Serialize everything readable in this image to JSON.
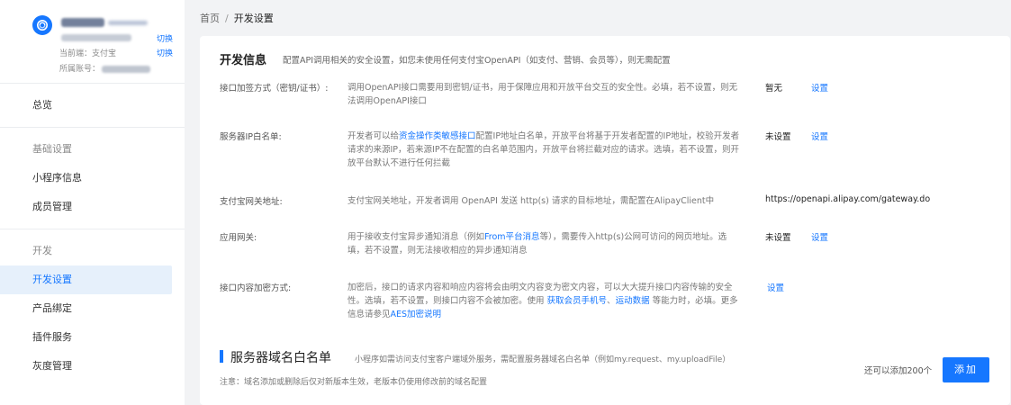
{
  "sidebar": {
    "switch_label_1": "切换",
    "switch_label_2": "切换",
    "current_end_label": "当前端：支付宝",
    "account_label": "所属账号：",
    "menu": {
      "overview": "总览",
      "group_basic": "基础设置",
      "miniapp_info": "小程序信息",
      "member_manage": "成员管理",
      "group_dev": "开发",
      "dev_settings": "开发设置",
      "product_binding": "产品绑定",
      "plugin_service": "插件服务",
      "gray_manage": "灰度管理"
    }
  },
  "breadcrumb": {
    "home": "首页",
    "separator": "/",
    "current": "开发设置"
  },
  "dev_info": {
    "title": "开发信息",
    "desc": "配置API调用相关的安全设置，如您未使用任何支付宝OpenAPI（如支付、营销、会员等），则无需配置",
    "rows": [
      {
        "label": "接口加签方式（密钥/证书）:",
        "desc": "调用OpenAPI接口需要用到密钥/证书，用于保障应用和开放平台交互的安全性。必填，若不设置，则无法调用OpenAPI接口",
        "status": "暂无",
        "action": "设置"
      },
      {
        "label": "服务器IP白名单:",
        "desc_pre": "开发者可以给",
        "desc_link": "资金操作类敏感接口",
        "desc_post": "配置IP地址白名单，开放平台将基于开发者配置的IP地址，校验开发者请求的来源IP，若来源IP不在配置的白名单范围内，开放平台将拦截对应的请求。选填，若不设置，则开放平台默认不进行任何拦截",
        "status": "未设置",
        "action": "设置"
      },
      {
        "label": "支付宝网关地址:",
        "desc": "支付宝网关地址，开发者调用 OpenAPI 发送 http(s) 请求的目标地址，需配置在AlipayClient中",
        "status": "https://openapi.alipay.com/gateway.do"
      },
      {
        "label": "应用网关:",
        "desc_pre": "用于接收支付宝异步通知消息（例如",
        "desc_link": "From平台消息",
        "desc_post": "等），需要传入http(s)公网可访问的网页地址。选填，若不设置，则无法接收相应的异步通知消息",
        "status": "未设置",
        "action": "设置"
      },
      {
        "label": "接口内容加密方式:",
        "desc_pre": "加密后，接口的请求内容和响应内容将会由明文内容变为密文内容，可以大大提升接口内容传输的安全性。选填，若不设置，则接口内容不会被加密。使用 ",
        "desc_link1": "获取会员手机号",
        "desc_mid": "、",
        "desc_link2": "运动数据",
        "desc_mid2": " 等能力时，必填。更多信息请参见",
        "desc_link3": "AES加密说明",
        "action": "设置"
      }
    ]
  },
  "domain_whitelist": {
    "title": "服务器域名白名单",
    "desc": "小程序如需访问支付宝客户端域外服务，需配置服务器域名白名单（例如my.request、my.uploadFile）",
    "note": "注意：域名添加或删除后仅对新版本生效，老版本仍使用修改前的域名配置",
    "quota": "还可以添加200个",
    "add_button": "添加"
  },
  "colors": {
    "accent": "#1677ff",
    "active_bg": "#e6f0fb",
    "page_bg": "#f2f3f5"
  }
}
